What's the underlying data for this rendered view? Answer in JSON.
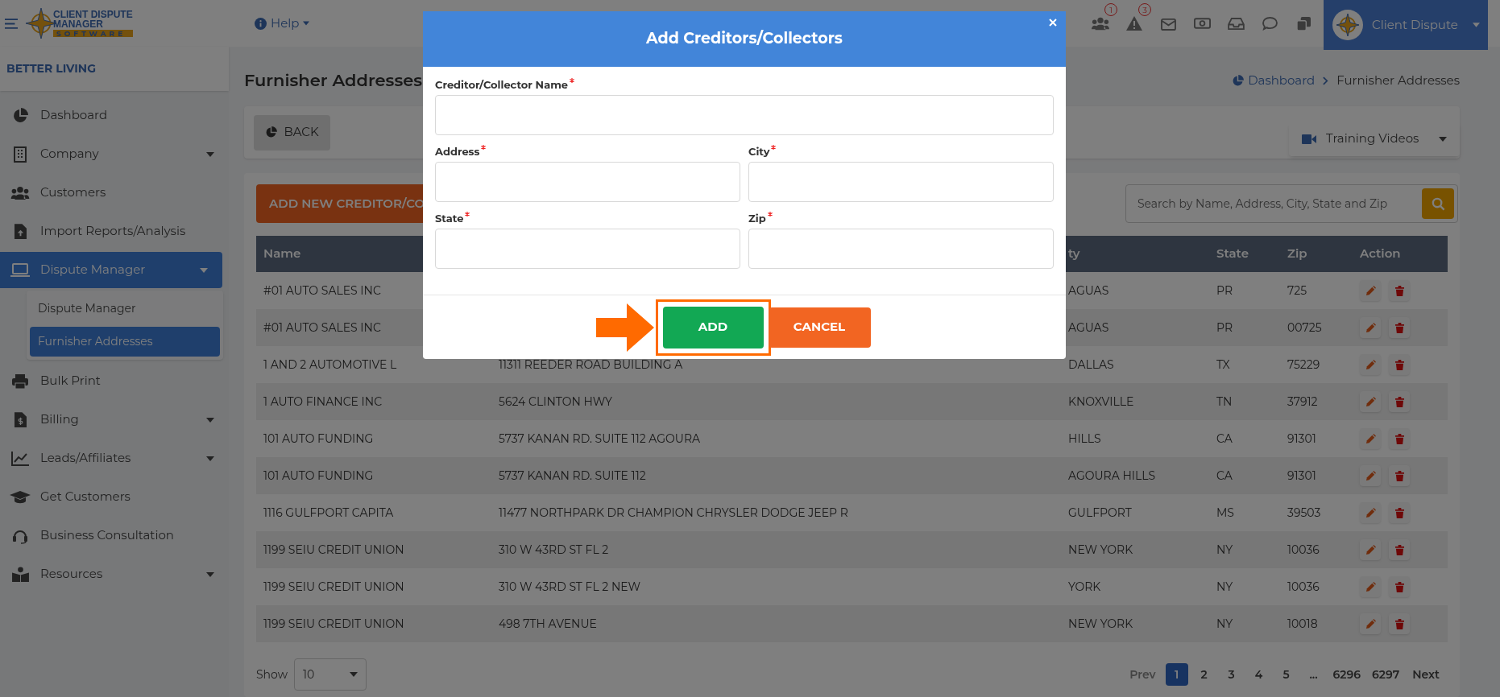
{
  "top_bar": {
    "logo": [
      "CLIENT DISPUTE",
      "MANAGER",
      "SOFTWARE"
    ],
    "help": "Help",
    "badges": [
      "1",
      "3"
    ],
    "profile": "Client Dispute"
  },
  "sidebar": {
    "company": "BETTER LIVING",
    "items": [
      {
        "label": "Dashboard",
        "has_submenu": false,
        "selected": false
      },
      {
        "label": "Company",
        "has_submenu": true,
        "selected": false
      },
      {
        "label": "Customers",
        "has_submenu": false,
        "selected": false
      },
      {
        "label": "Import Reports/Analysis",
        "has_submenu": false,
        "selected": false
      },
      {
        "label": "Dispute Manager",
        "has_submenu": true,
        "selected": true,
        "children": [
          {
            "label": "Dispute Manager",
            "selected": false
          },
          {
            "label": "Furnisher Addresses",
            "selected": true
          }
        ]
      },
      {
        "label": "Bulk Print",
        "has_submenu": false,
        "selected": false
      },
      {
        "label": "Billing",
        "has_submenu": true,
        "selected": false
      },
      {
        "label": "Leads/Affiliates",
        "has_submenu": true,
        "selected": false
      },
      {
        "label": "Get Customers",
        "has_submenu": false,
        "selected": false
      },
      {
        "label": "Business Consultation",
        "has_submenu": false,
        "selected": false
      },
      {
        "label": "Resources",
        "has_submenu": true,
        "selected": false
      }
    ]
  },
  "page": {
    "title": "Furnisher Addresses",
    "breadcrumb": [
      "Dashboard",
      "Furnisher Addresses"
    ],
    "back": "BACK",
    "training": "Training Videos",
    "add_button": "ADD NEW CREDITOR/CO",
    "search": {
      "placeholder": "Search by Name, Address, City, State and Zip"
    }
  },
  "table": {
    "columns": [
      "Name",
      "ty",
      "State",
      "Zip",
      "Action"
    ],
    "rows": [
      {
        "name": "#01 AUTO SALES INC",
        "city": "AGUAS",
        "state": "PR",
        "zip": "725"
      },
      {
        "name": "#01 AUTO SALES INC",
        "city": "AGUAS",
        "state": "PR",
        "zip": "00725"
      },
      {
        "name": "1 AND 2 AUTOMOTIVE L",
        "address": "11311 REEDER ROAD BUILDING A",
        "city": "DALLAS",
        "state": "TX",
        "zip": "75229"
      },
      {
        "name": "1 AUTO FINANCE INC",
        "address": "5624 CLINTON HWY",
        "city": "KNOXVILLE",
        "state": "TN",
        "zip": "37912"
      },
      {
        "name": "101 AUTO FUNDING",
        "address": "5737 KANAN RD. SUITE 112 AGOURA",
        "city": "HILLS",
        "state": "CA",
        "zip": "91301"
      },
      {
        "name": "101 AUTO FUNDING",
        "address": "5737 KANAN RD. SUITE 112",
        "city": "AGOURA HILLS",
        "state": "CA",
        "zip": "91301"
      },
      {
        "name": "1116 GULFPORT CAPITA",
        "address": "11477 NORTHPARK DR CHAMPION CHRYSLER DODGE JEEP R",
        "city": "GULFPORT",
        "state": "MS",
        "zip": "39503"
      },
      {
        "name": "1199 SEIU CREDIT UNION",
        "address": "310 W 43RD ST FL 2",
        "city": "NEW YORK",
        "state": "NY",
        "zip": "10036"
      },
      {
        "name": "1199 SEIU CREDIT UNION",
        "address": "310 W 43RD ST FL 2 NEW",
        "city": "YORK",
        "state": "NY",
        "zip": "10036"
      },
      {
        "name": "1199 SEIU CREDIT UNION",
        "address": "498 7TH AVENUE",
        "city": "NEW YORK",
        "state": "NY",
        "zip": "10018"
      }
    ]
  },
  "footer": {
    "show_label": "Show",
    "page_size": "10",
    "prev": "Prev",
    "next": "Next",
    "pages": [
      {
        "label": "1",
        "selected": true
      },
      {
        "label": "2",
        "selected": false
      },
      {
        "label": "3",
        "selected": false
      },
      {
        "label": "4",
        "selected": false
      },
      {
        "label": "5",
        "selected": false
      },
      {
        "label": "...",
        "selected": false
      },
      {
        "label": "6296",
        "selected": false
      },
      {
        "label": "6297",
        "selected": false
      }
    ]
  },
  "modal": {
    "title": "Add Creditors/Collectors",
    "fields": [
      {
        "label": "Creditor/Collector Name",
        "required": true
      },
      {
        "label": "Address",
        "required": true
      },
      {
        "label": "City",
        "required": true
      },
      {
        "label": "State",
        "required": true
      },
      {
        "label": "Zip",
        "required": true
      }
    ],
    "add": "ADD",
    "cancel": "CANCEL"
  }
}
